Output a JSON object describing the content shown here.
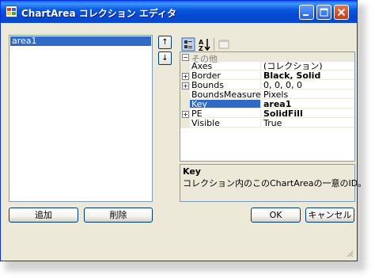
{
  "window": {
    "title": "ChartArea コレクション エディタ"
  },
  "members": {
    "items": [
      "area1"
    ]
  },
  "list_buttons": {
    "add": "追加",
    "remove": "削除"
  },
  "order_buttons": {
    "up": "↑",
    "down": "↓"
  },
  "property_grid": {
    "category": "その他",
    "rows": [
      {
        "name": "Axes",
        "value": "(コレクション)",
        "expandable": false,
        "bold": false
      },
      {
        "name": "Border",
        "value": "Black, Solid",
        "expandable": true,
        "bold": true
      },
      {
        "name": "Bounds",
        "value": "0, 0, 0, 0",
        "expandable": true,
        "bold": false
      },
      {
        "name": "BoundsMeasureType",
        "value": "Pixels",
        "expandable": false,
        "bold": false
      },
      {
        "name": "Key",
        "value": "area1",
        "expandable": false,
        "bold": true,
        "selected": true
      },
      {
        "name": "PE",
        "value": "SolidFill",
        "expandable": true,
        "bold": true
      },
      {
        "name": "Visible",
        "value": "True",
        "expandable": false,
        "bold": false
      }
    ]
  },
  "description": {
    "title": "Key",
    "text": "コレクション内のこのChartAreaの一意のID。"
  },
  "dialog_buttons": {
    "ok": "OK",
    "cancel": "キャンセル"
  },
  "colors": {
    "titlebar": "#0a58e0",
    "selection": "#316ac5",
    "face": "#ece9d8"
  }
}
